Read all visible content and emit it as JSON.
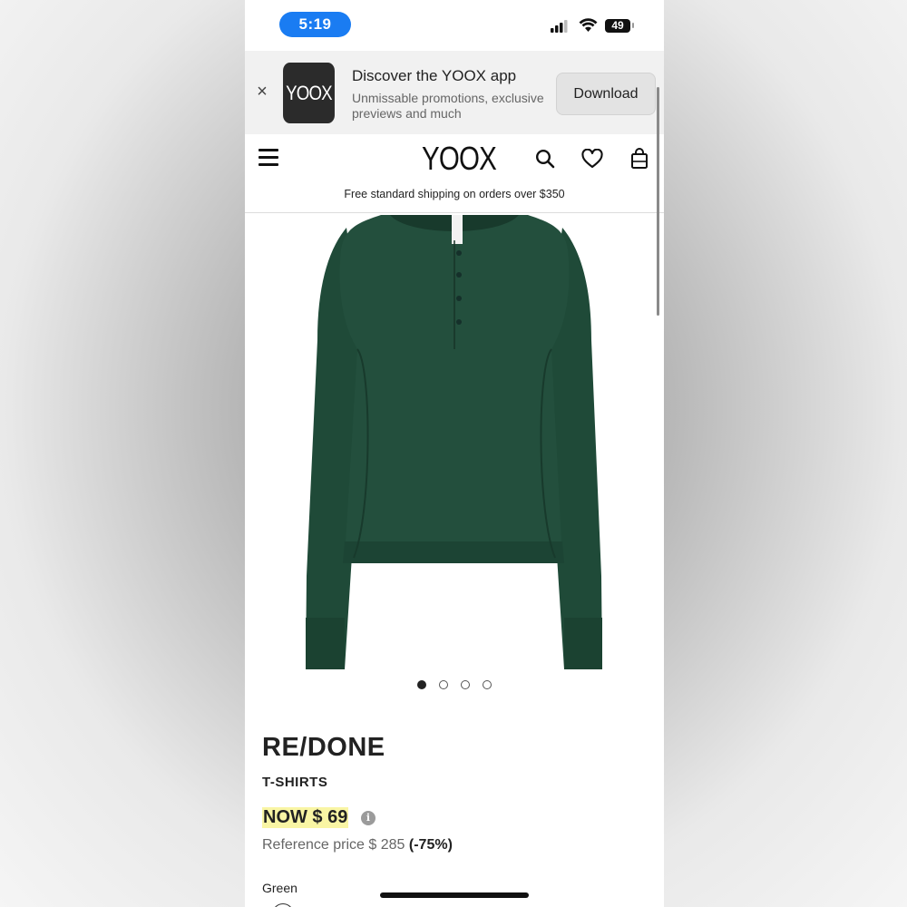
{
  "status_bar": {
    "time": "5:19",
    "battery": "49"
  },
  "app_banner": {
    "close_glyph": "×",
    "app_icon_text": "YOOX",
    "title": "Discover the YOOX app",
    "subtitle": "Unmissable promotions, exclusive previews and much",
    "download_label": "Download"
  },
  "header": {
    "logo": "YOOX",
    "shipping_text": "Free standard shipping on orders over $350",
    "icons": [
      "menu-icon",
      "search-icon",
      "heart-icon",
      "bag-icon"
    ]
  },
  "gallery": {
    "image": "green long-sleeve henley t-shirt",
    "image_color": "#1f4a38",
    "dots_count": 4,
    "active_dot": 1
  },
  "product": {
    "brand": "RE/DONE",
    "category": "T-SHIRTS",
    "price_now": "NOW $ 69",
    "info_glyph": "i",
    "ref_price_text": "Reference price $ 285",
    "discount": "(-75%)",
    "color_label": "Green"
  },
  "colors": {
    "time_pill": "#1a7cf2",
    "price_highlight": "#f9f5a4"
  }
}
